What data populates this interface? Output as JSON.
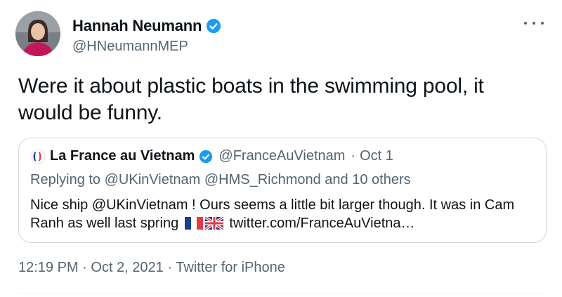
{
  "author": {
    "name": "Hannah Neumann",
    "handle": "@HNeumannMEP"
  },
  "tweet": {
    "text": "Were it about plastic boats in the swimming pool, it would be funny."
  },
  "quoted_tweet": {
    "name": "La France au Vietnam",
    "handle": "@FranceAuVietnam",
    "separator": "·",
    "date": "Oct 1",
    "replying_to": "Replying to @UKinVietnam @HMS_Richmond and 10 others",
    "body_text": "Nice ship @UKinVietnam ! Ours seems a little bit larger though. It was in Cam Ranh as well last spring",
    "link_text": "twitter.com/FranceAuVietna…"
  },
  "meta": {
    "time": "12:19 PM",
    "date": "Oct 2, 2021",
    "source": "Twitter for iPhone",
    "separator": "·"
  },
  "colors": {
    "verified": "#1d9bf0",
    "secondary_text": "#536471",
    "border": "#cfd9de"
  },
  "icons": {
    "verified": "verified-badge-icon",
    "more": "more-icon",
    "france_flag": "france-flag-icon",
    "uk_flag": "uk-flag-icon"
  }
}
